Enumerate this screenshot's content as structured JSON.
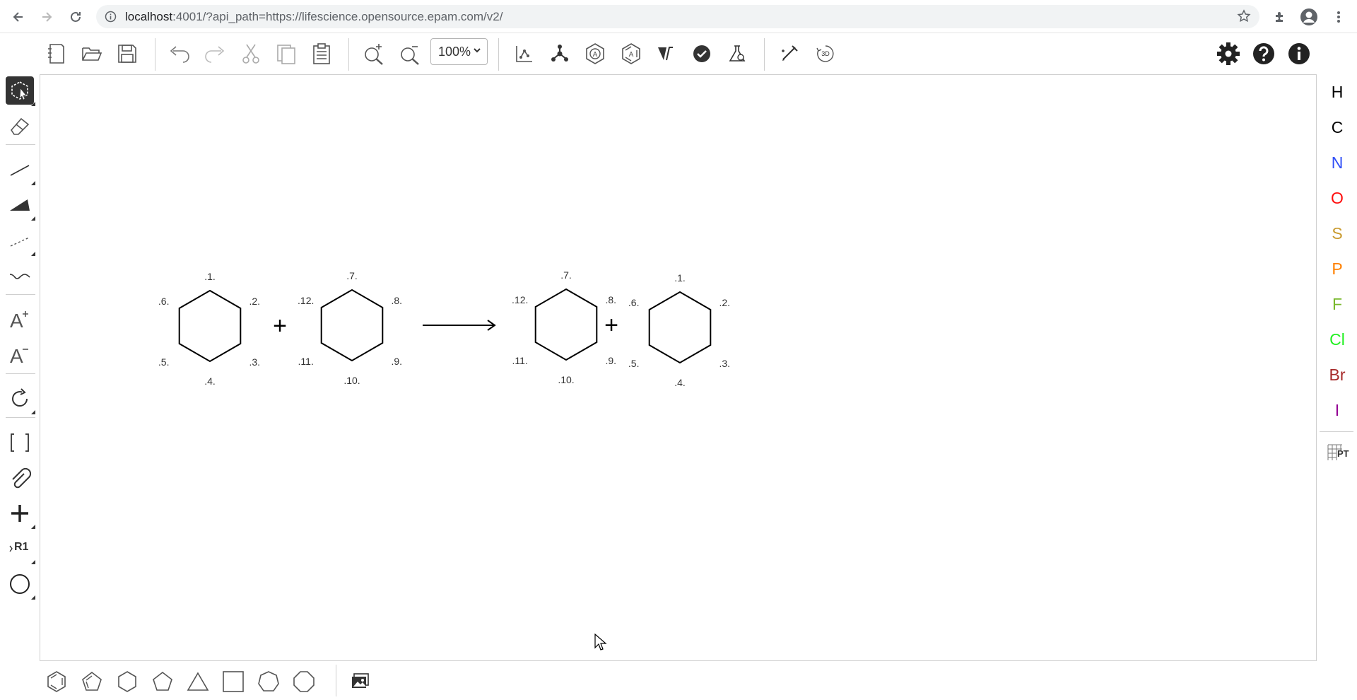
{
  "browser": {
    "url_host": "localhost",
    "url_rest": ":4001/?api_path=https://lifescience.opensource.epam.com/v2/"
  },
  "toolbar": {
    "zoom_value": "100%",
    "zoom_options": [
      "100%"
    ]
  },
  "left_toolbar": {
    "tools": [
      "select-lasso",
      "erase",
      "single-bond",
      "stereo-bond",
      "dashed-bond",
      "wavy-bond",
      "charge-plus",
      "charge-minus",
      "rotate",
      "sgroup-brackets",
      "attachment-point",
      "reaction-plus",
      "rgroup",
      "shape-circle"
    ],
    "rgroup_label": "R1"
  },
  "elements": [
    {
      "symbol": "H",
      "color": "#000000"
    },
    {
      "symbol": "C",
      "color": "#000000"
    },
    {
      "symbol": "N",
      "color": "#304ff7"
    },
    {
      "symbol": "O",
      "color": "#ff0d0d"
    },
    {
      "symbol": "S",
      "color": "#c99a2e"
    },
    {
      "symbol": "P",
      "color": "#ff8000"
    },
    {
      "symbol": "F",
      "color": "#78b82c"
    },
    {
      "symbol": "Cl",
      "color": "#1ff01f"
    },
    {
      "symbol": "Br",
      "color": "#a62929"
    },
    {
      "symbol": "I",
      "color": "#940094"
    }
  ],
  "periodic_table_label": "PT",
  "templates": [
    "benzene",
    "cyclopentadiene",
    "cyclohexane",
    "cyclopentane",
    "cyclopropane",
    "cyclobutane",
    "cycloheptane",
    "cyclooctane"
  ],
  "reaction": {
    "reactant_1": {
      "atom_labels": [
        ".1.",
        ".2.",
        ".3.",
        ".4.",
        ".5.",
        ".6."
      ]
    },
    "reactant_2": {
      "atom_labels": [
        ".7.",
        ".8.",
        ".9.",
        ".10.",
        ".11.",
        ".12."
      ]
    },
    "product_1": {
      "atom_labels": [
        ".7.",
        ".8.",
        ".9.",
        ".10.",
        ".11.",
        ".12."
      ]
    },
    "product_2": {
      "atom_labels": [
        ".1.",
        ".2.",
        ".3.",
        ".4.",
        ".5.",
        ".6."
      ]
    },
    "plus_symbol": "+"
  },
  "colors": {
    "accent_dark": "#333333",
    "separator": "#cfcfcf"
  }
}
